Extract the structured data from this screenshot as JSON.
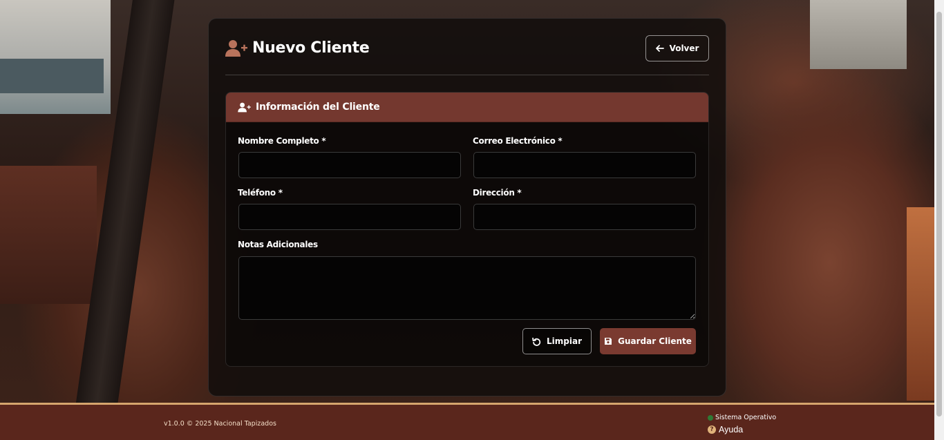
{
  "header": {
    "title": "Nuevo Cliente",
    "back_label": "Volver"
  },
  "panel": {
    "title": "Información del Cliente"
  },
  "form": {
    "nombre": {
      "label": "Nombre Completo *",
      "value": ""
    },
    "correo": {
      "label": "Correo Electrónico *",
      "value": ""
    },
    "telefono": {
      "label": "Teléfono *",
      "value": ""
    },
    "direccion": {
      "label": "Dirección *",
      "value": ""
    },
    "notas": {
      "label": "Notas Adicionales",
      "value": ""
    }
  },
  "actions": {
    "clear_label": "Limpiar",
    "save_label": "Guardar Cliente"
  },
  "footer": {
    "version": "v1.0.0 © 2025 Nacional Tapizados",
    "status": "Sistema Operativo",
    "help": "Ayuda"
  },
  "colors": {
    "accent": "#74382f",
    "footer_bg": "#5a261c",
    "footer_border": "#d6a56d",
    "status_ok": "#2f7a35"
  }
}
